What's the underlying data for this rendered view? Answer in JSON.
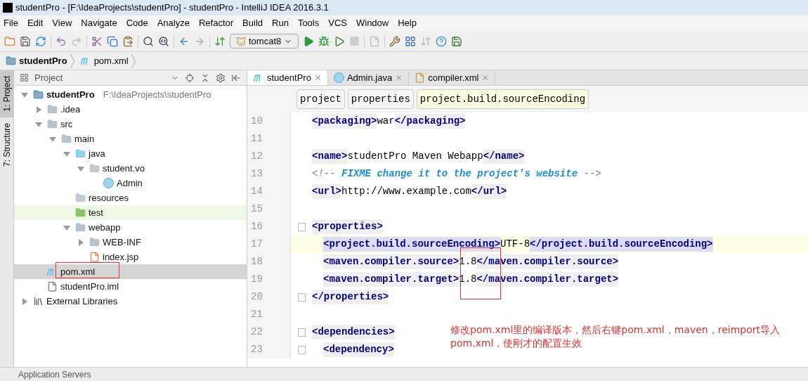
{
  "window": {
    "title": "studentPro - [F:\\IdeaProjects\\studentPro] - studentPro - IntelliJ IDEA 2016.3.1"
  },
  "menu": [
    "File",
    "Edit",
    "View",
    "Navigate",
    "Code",
    "Analyze",
    "Refactor",
    "Build",
    "Run",
    "Tools",
    "VCS",
    "Window",
    "Help"
  ],
  "toolbar": {
    "run_config": "tomcat8"
  },
  "breadcrumbs": [
    {
      "label": "studentPro",
      "kind": "module"
    },
    {
      "label": "pom.xml",
      "kind": "maven"
    }
  ],
  "side_tabs": [
    {
      "label": "1: Project",
      "selected": true
    },
    {
      "label": "7: Structure",
      "selected": false
    }
  ],
  "project_panel": {
    "title": "Project",
    "tree": [
      {
        "label": "studentPro",
        "hint": "F:\\IdeaProjects\\studentPro",
        "kind": "module",
        "expanded": true,
        "selected": false,
        "children": [
          {
            "label": ".idea",
            "kind": "folder",
            "expanded": false,
            "selected": false
          },
          {
            "label": "src",
            "kind": "folder",
            "expanded": true,
            "selected": false,
            "children": [
              {
                "label": "main",
                "kind": "folder",
                "expanded": true,
                "selected": false,
                "children": [
                  {
                    "label": "java",
                    "kind": "source",
                    "expanded": true,
                    "selected": false,
                    "children": [
                      {
                        "label": "student.vo",
                        "kind": "package",
                        "expanded": true,
                        "selected": false,
                        "children": [
                          {
                            "label": "Admin",
                            "kind": "class",
                            "selected": false
                          }
                        ]
                      }
                    ]
                  },
                  {
                    "label": "resources",
                    "kind": "resources",
                    "selected": false
                  },
                  {
                    "label": "test",
                    "kind": "test",
                    "selected": false
                  },
                  {
                    "label": "webapp",
                    "kind": "webapp",
                    "expanded": true,
                    "selected": false,
                    "children": [
                      {
                        "label": "WEB-INF",
                        "kind": "folder",
                        "expanded": false,
                        "selected": false
                      },
                      {
                        "label": "index.jsp",
                        "kind": "jsp",
                        "selected": false
                      }
                    ]
                  }
                ]
              }
            ]
          },
          {
            "label": "pom.xml",
            "kind": "maven",
            "selected": true
          },
          {
            "label": "studentPro.iml",
            "kind": "iml",
            "selected": false
          }
        ]
      },
      {
        "label": "External Libraries",
        "kind": "libraries",
        "expanded": false,
        "selected": false
      }
    ]
  },
  "editor_tabs": [
    {
      "label": "studentPro",
      "kind": "maven",
      "selected": true
    },
    {
      "label": "Admin.java",
      "kind": "class",
      "selected": false
    },
    {
      "label": "compiler.xml",
      "kind": "xml",
      "selected": false
    }
  ],
  "tag_path": [
    {
      "label": "project",
      "selected": false
    },
    {
      "label": "properties",
      "selected": false
    },
    {
      "label": "project.build.sourceEncoding",
      "selected": true
    }
  ],
  "code_lines": [
    {
      "number": "10",
      "fold": false,
      "current": false,
      "segments": [
        {
          "kind": "tag",
          "text": "<packaging>"
        },
        {
          "kind": "text",
          "text": "war"
        },
        {
          "kind": "tag",
          "text": "</packaging>"
        }
      ]
    },
    {
      "number": "11",
      "fold": false,
      "current": false
    },
    {
      "number": "12",
      "fold": false,
      "current": false,
      "segments": [
        {
          "kind": "tag",
          "text": "<name>"
        },
        {
          "kind": "text",
          "text": "studentPro Maven Webapp"
        },
        {
          "kind": "tag",
          "text": "</name>"
        }
      ]
    },
    {
      "number": "13",
      "fold": false,
      "current": false,
      "segments": [
        {
          "kind": "comment",
          "text": "<!-- "
        },
        {
          "kind": "doc",
          "text": "FIXME change it to the project's website"
        },
        {
          "kind": "comment",
          "text": " -->"
        }
      ]
    },
    {
      "number": "14",
      "fold": false,
      "current": false,
      "segments": [
        {
          "kind": "tag",
          "text": "<url>"
        },
        {
          "kind": "text",
          "text": "http://www.example.com"
        },
        {
          "kind": "tag",
          "text": "</url>"
        }
      ]
    },
    {
      "number": "15",
      "fold": false,
      "current": false
    },
    {
      "number": "16",
      "fold": true,
      "current": false,
      "segments": [
        {
          "kind": "tag",
          "text": "<properties>"
        }
      ],
      "children": [
        {
          "number": "17",
          "fold": false,
          "current": true,
          "segments": [
            {
              "kind": "match",
              "text": "<project.build.sourceEncoding>"
            },
            {
              "kind": "text",
              "text": "UTF-8"
            },
            {
              "kind": "match",
              "text": "</project.build.sourceEncoding>"
            }
          ]
        },
        {
          "number": "18",
          "fold": false,
          "current": false,
          "segments": [
            {
              "kind": "tag",
              "text": "<maven.compiler.source>"
            },
            {
              "kind": "text",
              "text": "1.8"
            },
            {
              "kind": "tag",
              "text": "</maven.compiler.source>"
            }
          ]
        },
        {
          "number": "19",
          "fold": false,
          "current": false,
          "segments": [
            {
              "kind": "tag",
              "text": "<maven.compiler.target>"
            },
            {
              "kind": "text",
              "text": "1.8"
            },
            {
              "kind": "tag",
              "text": "</maven.compiler.target>"
            }
          ]
        }
      ]
    },
    {
      "number": "20",
      "fold": true,
      "current": false,
      "segments": [
        {
          "kind": "tag",
          "text": "</properties>"
        }
      ]
    },
    {
      "number": "21",
      "fold": false,
      "current": false
    },
    {
      "number": "22",
      "fold": true,
      "current": false,
      "segments": [
        {
          "kind": "tag",
          "text": "<dependencies>"
        }
      ],
      "children": [
        {
          "number": "23",
          "fold": true,
          "current": false,
          "segments": [
            {
              "kind": "tag",
              "text": "<dependency>"
            }
          ]
        }
      ]
    }
  ],
  "annotation": {
    "text": "修改pom.xml里的编译版本，然后右键pom.xml，maven，reimport导入pom.xml，使刚才的配置生效"
  },
  "status_bar": {
    "text": "Application Servers"
  }
}
